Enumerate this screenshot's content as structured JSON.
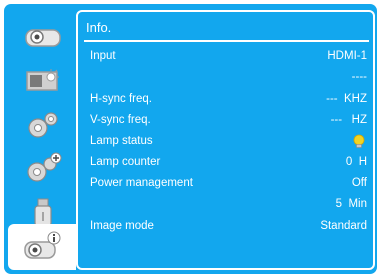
{
  "panel": {
    "title": "Info."
  },
  "rows": [
    {
      "label": "Input",
      "value": "HDMI-1"
    },
    {
      "label": "",
      "value": "----"
    },
    {
      "label": "H-sync freq.",
      "value": "---  KHZ"
    },
    {
      "label": "V-sync freq.",
      "value": "---   HZ"
    },
    {
      "label": "Lamp status",
      "value": "",
      "icon": "lamp-bulb-icon"
    },
    {
      "label": "Lamp counter",
      "value": "0  H"
    },
    {
      "label": "Power management",
      "value": "Off"
    },
    {
      "label": "",
      "value": "5  Min"
    },
    {
      "label": "Image mode",
      "value": "Standard"
    }
  ],
  "sidebar": {
    "items": [
      {
        "name": "display-menu",
        "icon": "projector-icon"
      },
      {
        "name": "image-menu",
        "icon": "image-adjust-icon"
      },
      {
        "name": "settings-menu",
        "icon": "gear-icon"
      },
      {
        "name": "expanded-settings-menu",
        "icon": "gear-plus-icon"
      },
      {
        "name": "usb-menu",
        "icon": "usb-drive-icon"
      },
      {
        "name": "info-menu",
        "icon": "projector-info-icon",
        "active": true
      }
    ]
  },
  "colors": {
    "background": "#12a7ee",
    "text": "#ffffff",
    "lamp": "#f2d422"
  }
}
